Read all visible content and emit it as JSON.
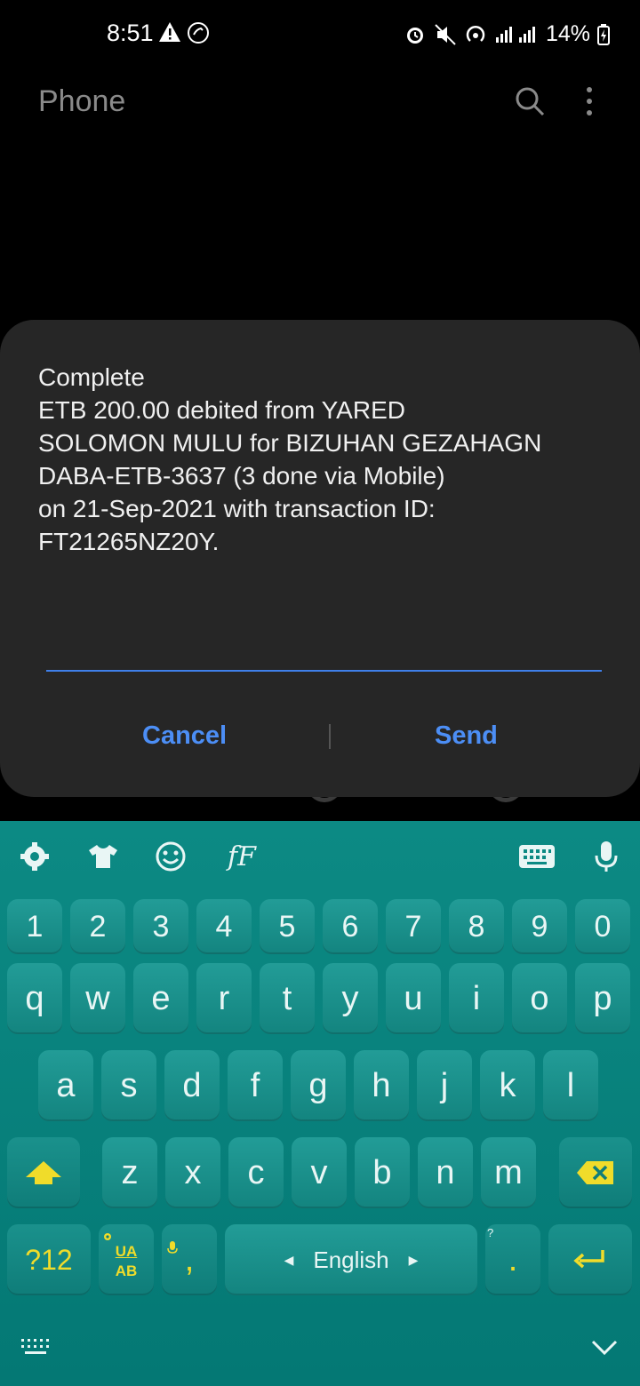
{
  "status_bar": {
    "time": "8:51",
    "battery": "14%"
  },
  "app": {
    "title": "Phone"
  },
  "dialog": {
    "message": "Complete\nETB 200.00 debited from YARED\nSOLOMON MULU for BIZUHAN GEZAHAGN\nDABA-ETB-3637 (3 done via Mobile)\non 21-Sep-2021 with transaction ID:\nFT21265NZ20Y.",
    "reply_value": "",
    "cancel_label": "Cancel",
    "send_label": "Send"
  },
  "keyboard": {
    "font_toggle_label": "fF",
    "number_row": [
      "1",
      "2",
      "3",
      "4",
      "5",
      "6",
      "7",
      "8",
      "9",
      "0"
    ],
    "row1": [
      "q",
      "w",
      "e",
      "r",
      "t",
      "y",
      "u",
      "i",
      "o",
      "p"
    ],
    "row2": [
      "a",
      "s",
      "d",
      "f",
      "g",
      "h",
      "j",
      "k",
      "l"
    ],
    "row3": [
      "z",
      "x",
      "c",
      "v",
      "b",
      "n",
      "m"
    ],
    "symbols_label": "?12",
    "lang_switch_top": "UA",
    "lang_switch_bottom": "AB",
    "comma_label": ",",
    "space_label": "English",
    "period_label": ".",
    "period_hint": "?",
    "accent_color": "#0a857f"
  }
}
